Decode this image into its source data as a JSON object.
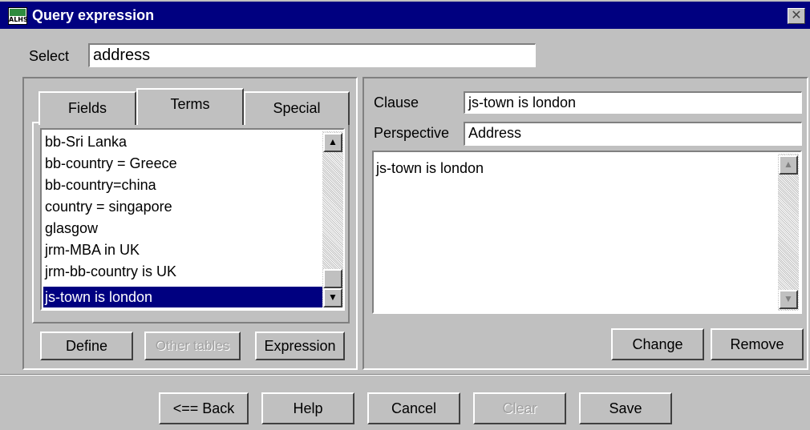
{
  "window": {
    "title": "Query expression",
    "app_icon_text": "ALHS",
    "close_glyph": "✕"
  },
  "select": {
    "label": "Select",
    "value": "address"
  },
  "left_panel": {
    "tabs": [
      {
        "label": "Fields",
        "active": false
      },
      {
        "label": "Terms",
        "active": true
      },
      {
        "label": "Special",
        "active": false
      }
    ],
    "list_items": [
      "bb-Sri Lanka",
      "bb-country = Greece",
      "bb-country=china",
      "country = singapore",
      "glasgow",
      "jrm-MBA in UK",
      "jrm-bb-country is UK",
      "js-town is london"
    ],
    "selected_item": "js-town is london",
    "buttons": {
      "define": "Define",
      "other_tables": "Other tables",
      "expression": "Expression"
    }
  },
  "right_panel": {
    "clause_label": "Clause",
    "clause_value": "js-town is london",
    "perspective_label": "Perspective",
    "perspective_value": "Address",
    "expression_text": "js-town is london",
    "buttons": {
      "change": "Change",
      "remove": "Remove"
    }
  },
  "footer": {
    "back": "<== Back",
    "help": "Help",
    "cancel": "Cancel",
    "clear": "Clear",
    "save": "Save"
  },
  "colors": {
    "face": "#c0c0c0",
    "titlebar": "#000080",
    "selection": "#000080"
  }
}
